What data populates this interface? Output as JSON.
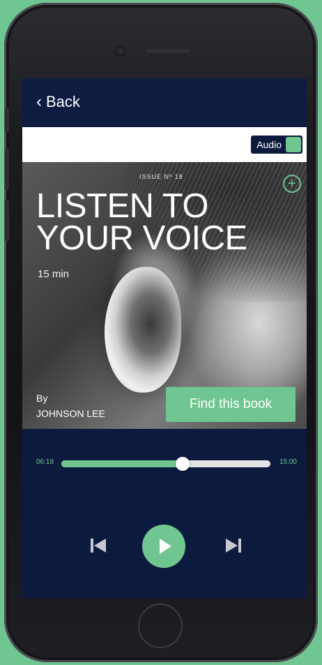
{
  "nav": {
    "back_label": "Back"
  },
  "toggle": {
    "audio_label": "Audio"
  },
  "cover": {
    "issue": "ISSUE Nº 18",
    "title_line1": "LISTEN TO",
    "title_line2": "YOUR VOICE",
    "duration": "15 min",
    "by_label": "By",
    "author": "JOHNSON LEE",
    "find_button_label": "Find this book"
  },
  "player": {
    "elapsed": "06:18",
    "total": "15:00",
    "progress_fraction": 0.58
  },
  "icons": {
    "back": "chevron-left-icon",
    "add": "plus-circle-icon",
    "prev": "skip-previous-icon",
    "play": "play-icon",
    "next": "skip-next-icon"
  },
  "colors": {
    "accent": "#6fc690",
    "navy": "#0c1a3e",
    "background": "#6fc690"
  }
}
